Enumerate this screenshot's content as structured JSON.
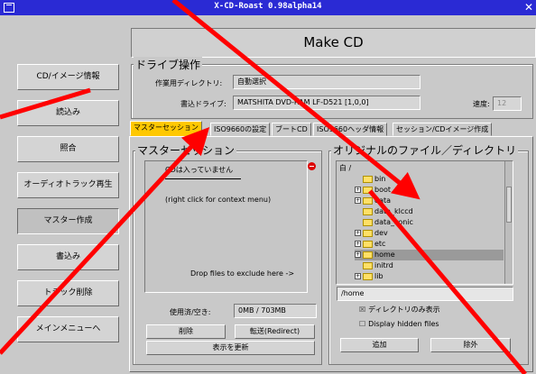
{
  "window": {
    "title": "X-CD-Roast 0.98alpha14"
  },
  "sidebar": {
    "items": [
      {
        "label": "CD/イメージ情報",
        "active": false
      },
      {
        "label": "読込み",
        "active": false
      },
      {
        "label": "照合",
        "active": false
      },
      {
        "label": "オーディオトラック再生",
        "active": false
      },
      {
        "label": "マスター作成",
        "active": true
      },
      {
        "label": "書込み",
        "active": false
      },
      {
        "label": "トラック削除",
        "active": false
      },
      {
        "label": "メインメニューへ",
        "active": false
      }
    ]
  },
  "header": {
    "title": "Make CD"
  },
  "drive": {
    "section_label": "ドライブ操作",
    "workdir_label": "作業用ディレクトリ:",
    "workdir_value": "自動選択",
    "writer_label": "書込ドライブ:",
    "writer_value": "MATSHITA DVD-RAM LF-D521 [1,0,0]",
    "speed_label": "速度:",
    "speed_value": "12"
  },
  "tabs": [
    {
      "label": "マスターセッション",
      "selected": true
    },
    {
      "label": "ISO9660の設定",
      "selected": false
    },
    {
      "label": "ブートCD",
      "selected": false
    },
    {
      "label": "ISO9660ヘッダ情報",
      "selected": false
    },
    {
      "label": "セッション/CDイメージ作成",
      "selected": false
    }
  ],
  "master": {
    "section_label": "マスターセッション",
    "list_lines": [
      "CDは入っていません",
      "(right click for context menu)"
    ],
    "drop_hint": "Drop files to exclude here ->",
    "usage_label": "使用済/空き:",
    "usage_value": "0MB / 703MB",
    "delete_button": "削除",
    "redirect_button": "転送(Redirect)",
    "refresh_button": "表示を更新"
  },
  "original": {
    "section_label": "オリジナルのファイル／ディレクトリ",
    "tree_root": "白 /",
    "tree_items": [
      {
        "name": "bin",
        "expander": false,
        "selected": false
      },
      {
        "name": "boot",
        "expander": true,
        "selected": false
      },
      {
        "name": "data",
        "expander": true,
        "selected": false
      },
      {
        "name": "data_klccd",
        "expander": false,
        "selected": false
      },
      {
        "name": "data_konic",
        "expander": false,
        "selected": false
      },
      {
        "name": "dev",
        "expander": true,
        "selected": false
      },
      {
        "name": "etc",
        "expander": true,
        "selected": false
      },
      {
        "name": "home",
        "expander": true,
        "selected": true
      },
      {
        "name": "initrd",
        "expander": false,
        "selected": false
      },
      {
        "name": "lib",
        "expander": true,
        "selected": false
      }
    ],
    "path_value": "/home",
    "dirs_only_label": "ディレクトリのみ表示",
    "dirs_only_checked": true,
    "hidden_files_label": "Display hidden files",
    "hidden_files_checked": false,
    "add_button": "追加",
    "exclude_button": "除外"
  },
  "colors": {
    "titlebar": "#2a2ad4",
    "selected_tab": "#ffc800",
    "annotation_arrow": "#ff0000"
  }
}
